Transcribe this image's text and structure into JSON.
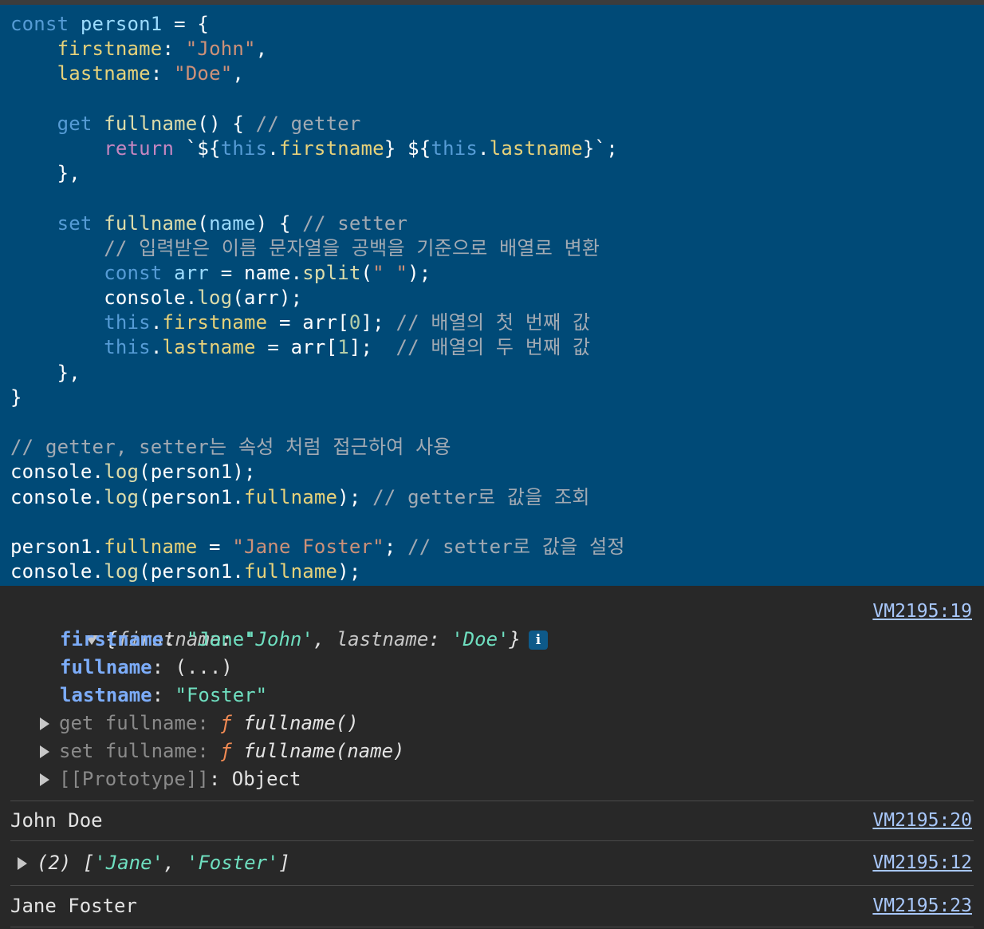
{
  "editor": {
    "lines": [
      [
        {
          "t": "const",
          "c": "kw"
        },
        {
          "t": " "
        },
        {
          "t": "person1",
          "c": "var"
        },
        {
          "t": " = {"
        }
      ],
      [
        {
          "t": "    "
        },
        {
          "t": "firstname",
          "c": "prop"
        },
        {
          "t": ": "
        },
        {
          "t": "\"John\"",
          "c": "str"
        },
        {
          "t": ","
        }
      ],
      [
        {
          "t": "    "
        },
        {
          "t": "lastname",
          "c": "prop"
        },
        {
          "t": ": "
        },
        {
          "t": "\"Doe\"",
          "c": "str"
        },
        {
          "t": ","
        }
      ],
      [
        {
          "t": ""
        }
      ],
      [
        {
          "t": "    "
        },
        {
          "t": "get",
          "c": "kw"
        },
        {
          "t": " "
        },
        {
          "t": "fullname",
          "c": "fn"
        },
        {
          "t": "() { "
        },
        {
          "t": "// getter",
          "c": "cmt"
        }
      ],
      [
        {
          "t": "        "
        },
        {
          "t": "return",
          "c": "ctl"
        },
        {
          "t": " `${"
        },
        {
          "t": "this",
          "c": "kw"
        },
        {
          "t": "."
        },
        {
          "t": "firstname",
          "c": "prop"
        },
        {
          "t": "} ${"
        },
        {
          "t": "this",
          "c": "kw"
        },
        {
          "t": "."
        },
        {
          "t": "lastname",
          "c": "prop"
        },
        {
          "t": "}`;"
        }
      ],
      [
        {
          "t": "    },"
        }
      ],
      [
        {
          "t": ""
        }
      ],
      [
        {
          "t": "    "
        },
        {
          "t": "set",
          "c": "kw"
        },
        {
          "t": " "
        },
        {
          "t": "fullname",
          "c": "fn"
        },
        {
          "t": "("
        },
        {
          "t": "name",
          "c": "var"
        },
        {
          "t": ") { "
        },
        {
          "t": "// setter",
          "c": "cmt"
        }
      ],
      [
        {
          "t": "        "
        },
        {
          "t": "// 입력받은 이름 문자열을 공백을 기준으로 배열로 변환",
          "c": "cmt"
        }
      ],
      [
        {
          "t": "        "
        },
        {
          "t": "const",
          "c": "kw"
        },
        {
          "t": " "
        },
        {
          "t": "arr",
          "c": "var"
        },
        {
          "t": " = name."
        },
        {
          "t": "split",
          "c": "fn"
        },
        {
          "t": "("
        },
        {
          "t": "\" \"",
          "c": "str"
        },
        {
          "t": ");"
        }
      ],
      [
        {
          "t": "        console."
        },
        {
          "t": "log",
          "c": "fn"
        },
        {
          "t": "(arr);"
        }
      ],
      [
        {
          "t": "        "
        },
        {
          "t": "this",
          "c": "kw"
        },
        {
          "t": "."
        },
        {
          "t": "firstname",
          "c": "prop"
        },
        {
          "t": " = arr["
        },
        {
          "t": "0",
          "c": "num"
        },
        {
          "t": "]; "
        },
        {
          "t": "// 배열의 첫 번째 값",
          "c": "cmt"
        }
      ],
      [
        {
          "t": "        "
        },
        {
          "t": "this",
          "c": "kw"
        },
        {
          "t": "."
        },
        {
          "t": "lastname",
          "c": "prop"
        },
        {
          "t": " = arr["
        },
        {
          "t": "1",
          "c": "num"
        },
        {
          "t": "];  "
        },
        {
          "t": "// 배열의 두 번째 값",
          "c": "cmt"
        }
      ],
      [
        {
          "t": "    },"
        }
      ],
      [
        {
          "t": "}"
        }
      ],
      [
        {
          "t": ""
        }
      ],
      [
        {
          "t": "// getter, setter는 속성 처럼 접근하여 사용",
          "c": "cmt"
        }
      ],
      [
        {
          "t": "console."
        },
        {
          "t": "log",
          "c": "fn"
        },
        {
          "t": "(person1);"
        }
      ],
      [
        {
          "t": "console."
        },
        {
          "t": "log",
          "c": "fn"
        },
        {
          "t": "(person1."
        },
        {
          "t": "fullname",
          "c": "prop"
        },
        {
          "t": "); "
        },
        {
          "t": "// getter로 값을 조회",
          "c": "cmt"
        }
      ],
      [
        {
          "t": ""
        }
      ],
      [
        {
          "t": "person1."
        },
        {
          "t": "fullname",
          "c": "prop"
        },
        {
          "t": " = "
        },
        {
          "t": "\"Jane Foster\"",
          "c": "str"
        },
        {
          "t": "; "
        },
        {
          "t": "// setter로 값을 설정",
          "c": "cmt"
        }
      ],
      [
        {
          "t": "console."
        },
        {
          "t": "log",
          "c": "fn"
        },
        {
          "t": "(person1."
        },
        {
          "t": "fullname",
          "c": "prop"
        },
        {
          "t": ");"
        }
      ]
    ]
  },
  "console": {
    "object_entry": {
      "summary_open": "{",
      "summary_k1": "firstname",
      "summary_v1": "'John'",
      "summary_k2": "lastname",
      "summary_v2": "'Doe'",
      "summary_close": "}",
      "info_badge": "i",
      "source": "VM2195:19",
      "props": [
        {
          "key": "firstname",
          "value": "\"Jane\""
        },
        {
          "key": "fullname",
          "value": "(...)"
        },
        {
          "key": "lastname",
          "value": "\"Foster\""
        }
      ],
      "accessors": [
        {
          "prefix": "get fullname",
          "f": "ƒ",
          "sig": "fullname()"
        },
        {
          "prefix": "set fullname",
          "f": "ƒ",
          "sig": "fullname(name)"
        }
      ],
      "prototype": {
        "label": "[[Prototype]]",
        "value": "Object"
      }
    },
    "messages": [
      {
        "text": "John Doe",
        "source": "VM2195:20"
      },
      {
        "count": "(2)",
        "open": "[",
        "items": [
          "'Jane'",
          "'Foster'"
        ],
        "close": "]",
        "source": "VM2195:12"
      },
      {
        "text": "Jane Foster",
        "source": "VM2195:23"
      }
    ],
    "icons": {
      "expand": "chevron-down-icon",
      "collapse": "chevron-right-icon"
    }
  }
}
